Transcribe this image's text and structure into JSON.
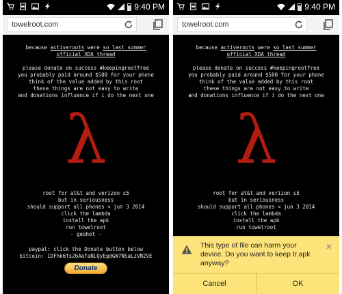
{
  "status_bar": {
    "time": "9:40 PM"
  },
  "browser": {
    "url": "towelroot.com"
  },
  "page": {
    "line_because": [
      "because ",
      "activeroots",
      " were ",
      "so last summer"
    ],
    "xda_thread": "official XDA thread",
    "donate_lines": [
      "please donate on success #keepingrootfree",
      "you probably paid around $500 for your phone",
      "think of the value added by this root",
      "these things are not easy to write",
      "and donations influence if i do the next one"
    ],
    "lambda_symbol": "λ",
    "info_lines": [
      "root for at&t and verizon s5",
      "but in seriousness",
      "should support all phones < jun 3 2014",
      "click the lambda",
      "install the apk",
      "run towelroot",
      "- geohot -"
    ],
    "paypal_line": "paypal: click the Donate button below",
    "bitcoin_line": "bitcoin: 1DFhk6fs26AafaNLQyEgdGW7NSaLzVN2VE",
    "donate_button": "Donate"
  },
  "download_warning": {
    "message": "This type of file can harm your device. Do you want to keep tr.apk anyway?",
    "close": "✕",
    "cancel": "Cancel",
    "ok": "OK"
  },
  "colors": {
    "lambda": "#b21d12",
    "dialog_bg": "#fde37a",
    "page_bg": "#000000"
  }
}
